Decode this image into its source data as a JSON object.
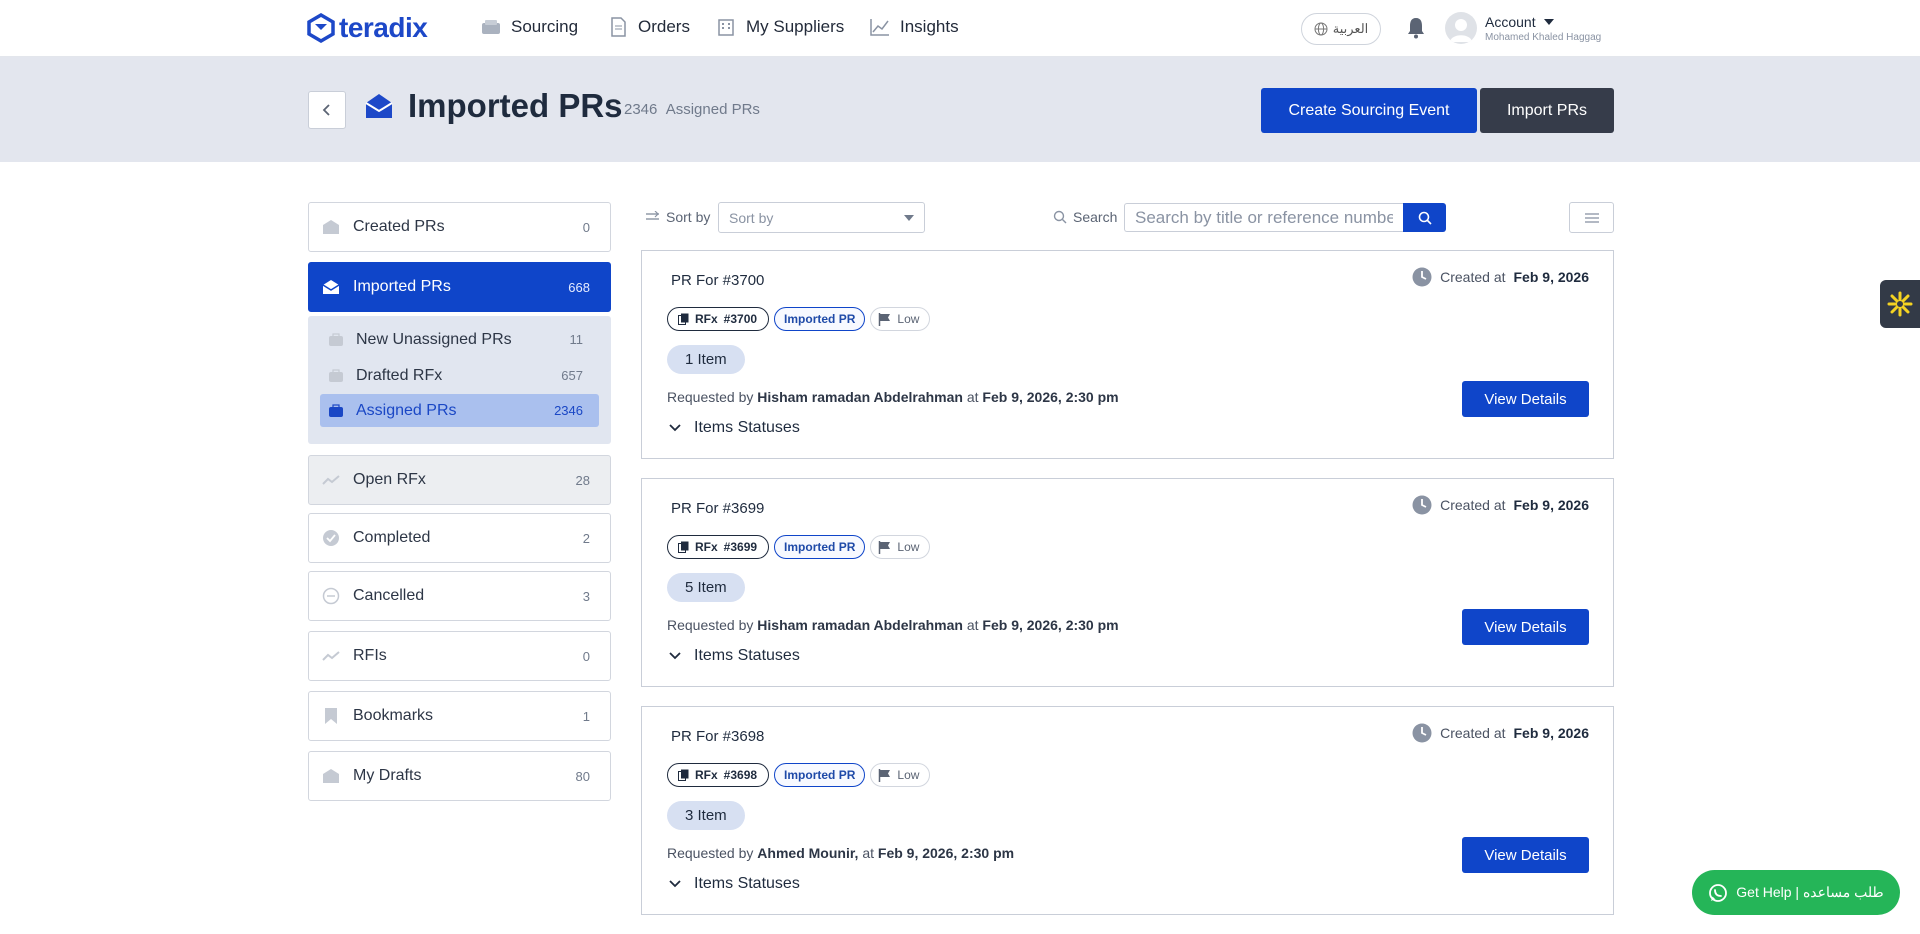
{
  "nav": {
    "brand": "teradix",
    "items": [
      {
        "label": "Sourcing",
        "icon": "sourcing-box-icon"
      },
      {
        "label": "Orders",
        "icon": "document-icon"
      },
      {
        "label": "My Suppliers",
        "icon": "building-icon"
      },
      {
        "label": "Insights",
        "icon": "chart-line-icon"
      }
    ],
    "language_label": "العربية",
    "account": {
      "title": "Account",
      "user_name": "Mohamed Khaled Haggag"
    }
  },
  "header": {
    "title": "Imported PRs",
    "count": "2346",
    "count_label": "Assigned PRs",
    "primary_button": "Create Sourcing Event",
    "secondary_button": "Import PRs"
  },
  "sidebar": {
    "items": [
      {
        "label": "Created PRs",
        "count": "0"
      },
      {
        "label": "Imported PRs",
        "count": "668"
      },
      {
        "label": "Open RFx",
        "count": "28"
      },
      {
        "label": "Completed",
        "count": "2"
      },
      {
        "label": "Cancelled",
        "count": "3"
      },
      {
        "label": "RFIs",
        "count": "0"
      },
      {
        "label": "Bookmarks",
        "count": "1"
      },
      {
        "label": "My Drafts",
        "count": "80"
      }
    ],
    "subitems": [
      {
        "label": "New Unassigned PRs",
        "count": "11"
      },
      {
        "label": "Drafted RFx",
        "count": "657"
      },
      {
        "label": "Assigned PRs",
        "count": "2346"
      }
    ]
  },
  "toolbar": {
    "sort_label": "Sort by",
    "sort_placeholder": "Sort by",
    "search_label": "Search",
    "search_placeholder": "Search by title or reference number"
  },
  "cards": [
    {
      "title": "PR For #3700",
      "created_label": "Created at",
      "created_date": "Feb 9, 2026",
      "rfx_tag": "RFx",
      "rfx_number": "#3700",
      "imported_tag": "Imported PR",
      "priority": "Low",
      "items": "1 Item",
      "requested_by_label": "Requested by",
      "requester": "Hisham ramadan Abdelrahman",
      "at_label": "at",
      "requested_at": "Feb 9, 2026, 2:30 pm",
      "statuses_label": "Items Statuses",
      "view_button": "View Details"
    },
    {
      "title": "PR For #3699",
      "created_label": "Created at",
      "created_date": "Feb 9, 2026",
      "rfx_tag": "RFx",
      "rfx_number": "#3699",
      "imported_tag": "Imported PR",
      "priority": "Low",
      "items": "5 Item",
      "requested_by_label": "Requested by",
      "requester": "Hisham ramadan Abdelrahman",
      "at_label": "at",
      "requested_at": "Feb 9, 2026, 2:30 pm",
      "statuses_label": "Items Statuses",
      "view_button": "View Details"
    },
    {
      "title": "PR For #3698",
      "created_label": "Created at",
      "created_date": "Feb 9, 2026",
      "rfx_tag": "RFx",
      "rfx_number": "#3698",
      "imported_tag": "Imported PR",
      "priority": "Low",
      "items": "3 Item",
      "requested_by_label": "Requested by",
      "requester": "Ahmed Mounir,",
      "at_label": "at",
      "requested_at": "Feb 9, 2026, 2:30 pm",
      "statuses_label": "Items Statuses",
      "view_button": "View Details"
    }
  ],
  "help_button": "Get Help | طلب مساعده",
  "colors": {
    "brand_blue": "#0f45c9",
    "dark_button": "#363c4a",
    "help_green": "#25b558",
    "banner_bg": "#e3e6ee"
  }
}
